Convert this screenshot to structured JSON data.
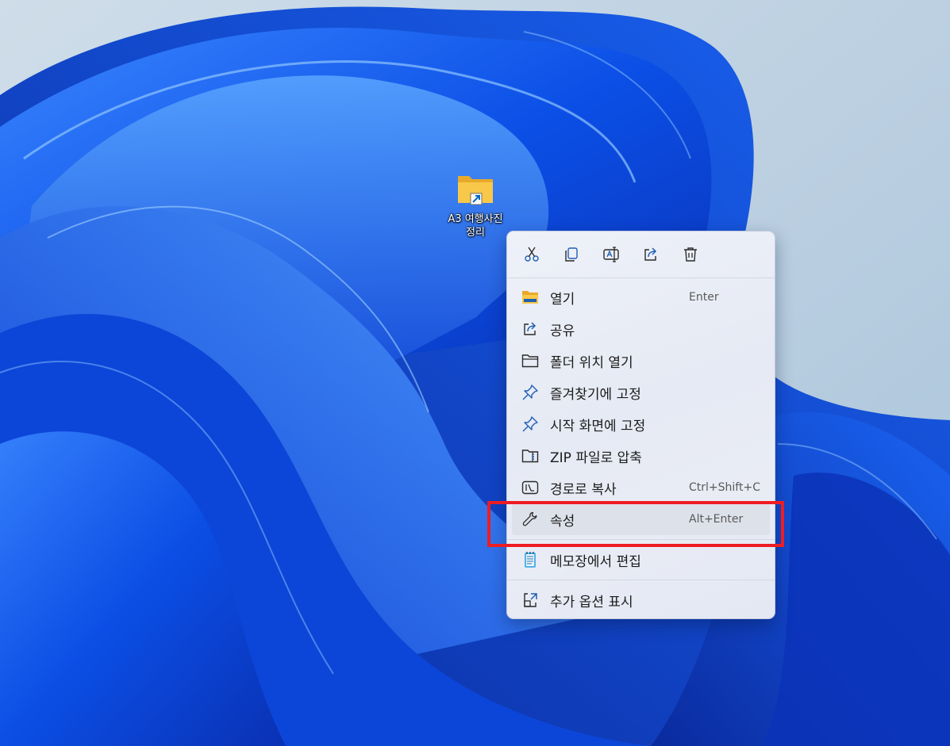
{
  "desktop": {
    "icon": {
      "label": "A3 여행사진\n정리",
      "icon_name": "folder-shortcut-icon",
      "folder_color": "#f8c84a"
    }
  },
  "context_menu": {
    "quick_actions": [
      {
        "name": "cut",
        "icon": "scissors-icon"
      },
      {
        "name": "copy",
        "icon": "copy-icon"
      },
      {
        "name": "rename",
        "icon": "rename-icon"
      },
      {
        "name": "share",
        "icon": "share-icon"
      },
      {
        "name": "delete",
        "icon": "trash-icon"
      }
    ],
    "items": [
      {
        "label": "열기",
        "shortcut": "Enter",
        "icon": "folder-open-icon"
      },
      {
        "label": "공유",
        "shortcut": "",
        "icon": "share-icon"
      },
      {
        "label": "폴더 위치 열기",
        "shortcut": "",
        "icon": "folder-outline-icon"
      },
      {
        "label": "즐겨찾기에 고정",
        "shortcut": "",
        "icon": "pin-icon"
      },
      {
        "label": "시작 화면에 고정",
        "shortcut": "",
        "icon": "pin-icon"
      },
      {
        "label": "ZIP 파일로 압축",
        "shortcut": "",
        "icon": "zip-folder-icon"
      },
      {
        "label": "경로로 복사",
        "shortcut": "Ctrl+Shift+C",
        "icon": "copy-path-icon"
      },
      {
        "label": "속성",
        "shortcut": "Alt+Enter",
        "icon": "wrench-icon",
        "selected": true
      },
      {
        "label": "메모장에서 편집",
        "shortcut": "",
        "icon": "notepad-icon"
      },
      {
        "label": "추가 옵션 표시",
        "shortcut": "",
        "icon": "more-options-icon"
      }
    ]
  },
  "annotation": {
    "highlight_color": "#ee1c24",
    "highlighted_item": "속성"
  },
  "colors": {
    "accent": "#0067c0",
    "wallpaper_blue": "#0a4be0"
  }
}
